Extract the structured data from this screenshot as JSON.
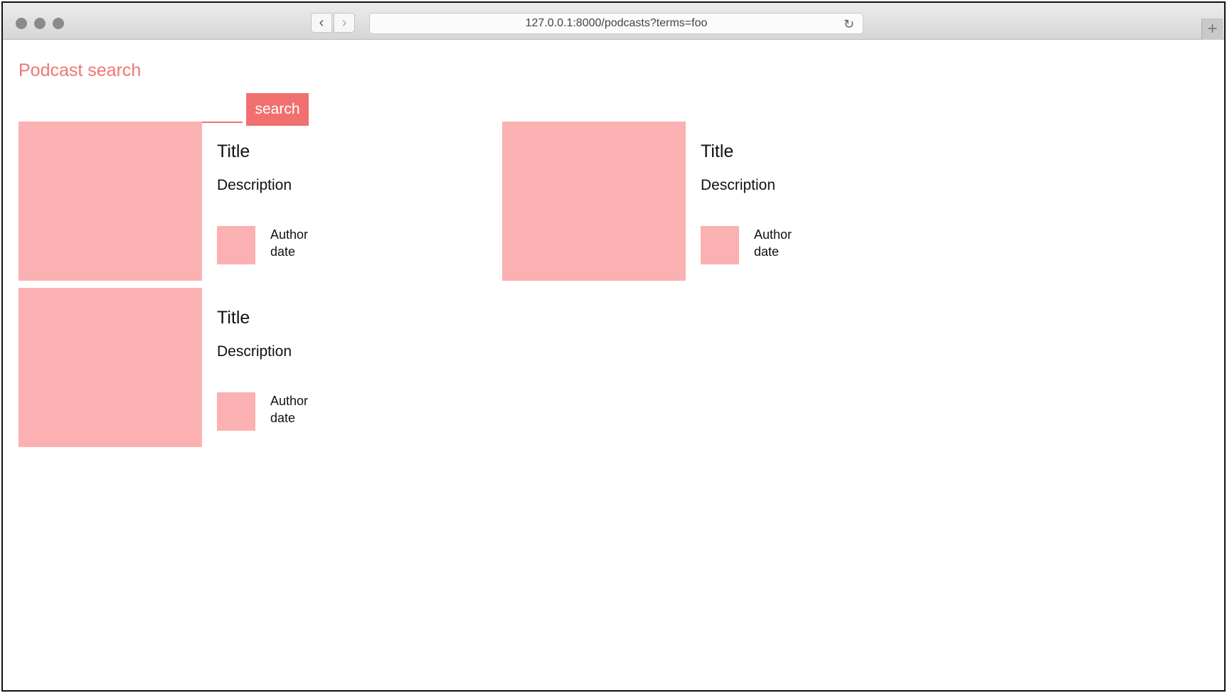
{
  "browser": {
    "url": "127.0.0.1:8000/podcasts?terms=foo",
    "back_glyph": "‹",
    "forward_glyph": "›",
    "reload_glyph": "↻",
    "new_tab_glyph": "+"
  },
  "page": {
    "title": "Podcast search",
    "search": {
      "value": "",
      "placeholder": "",
      "button_label": "search"
    }
  },
  "results": [
    {
      "title": "Title",
      "description": "Description",
      "author": "Author",
      "date": "date"
    },
    {
      "title": "Title",
      "description": "Description",
      "author": "Author",
      "date": "date"
    },
    {
      "title": "Title",
      "description": "Description",
      "author": "Author",
      "date": "date"
    }
  ],
  "colors": {
    "accent": "#f07575",
    "placeholder_pink": "#fbb1b1"
  }
}
